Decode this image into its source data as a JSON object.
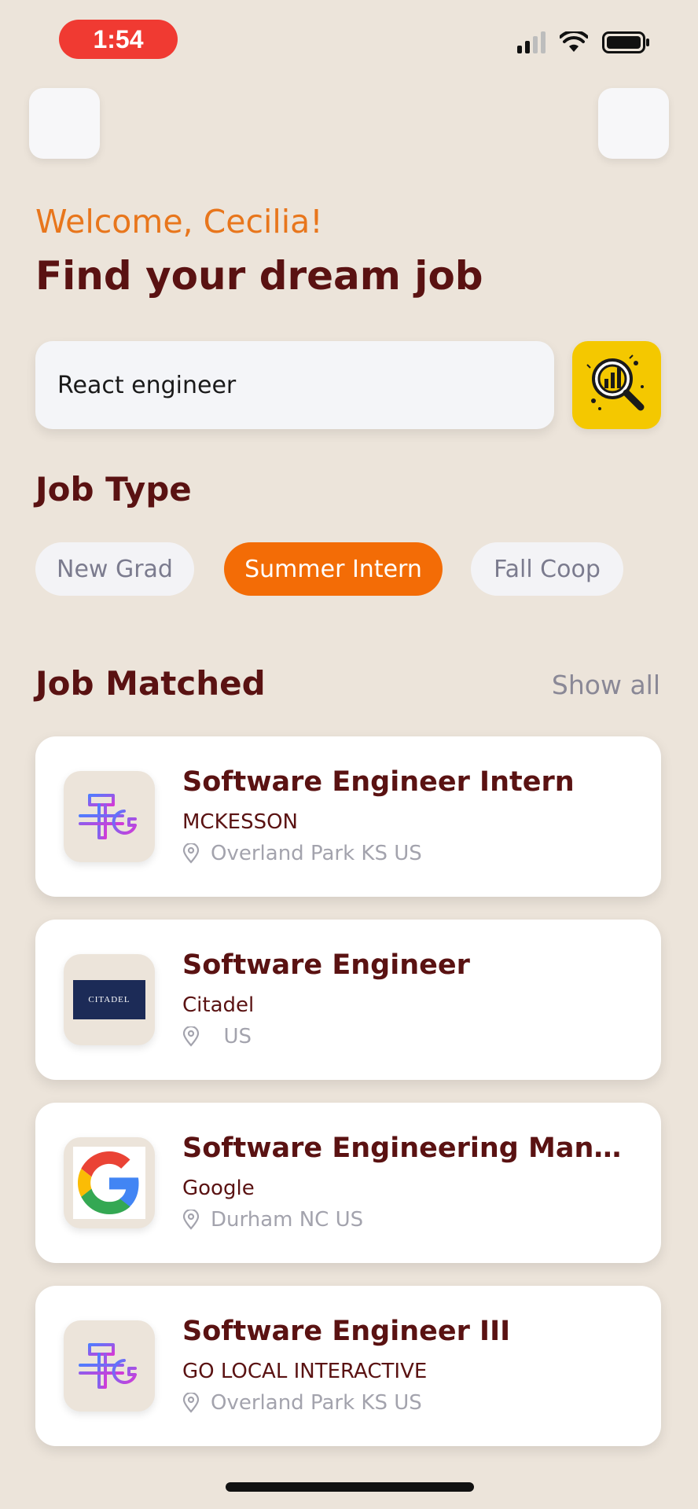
{
  "status_bar": {
    "time": "1:54",
    "icons": [
      "cellular-signal-icon",
      "wifi-icon",
      "battery-icon"
    ],
    "recording_color": "#f03a32"
  },
  "header": {
    "welcome": "Welcome, Cecilia!",
    "headline": "Find your dream job"
  },
  "search": {
    "value": "React engineer",
    "button_icon": "search-chart-icon",
    "button_color": "#f4c800"
  },
  "job_type": {
    "title": "Job Type",
    "chips": [
      {
        "label": "New Grad",
        "active": false
      },
      {
        "label": "Summer Intern",
        "active": true
      },
      {
        "label": "Fall Coop",
        "active": false
      }
    ]
  },
  "matched": {
    "title": "Job Matched",
    "show_all": "Show all",
    "jobs": [
      {
        "title": "Software Engineer Intern",
        "company": "MCKESSON",
        "location": "Overland Park KS US",
        "logo": "tools-icon"
      },
      {
        "title": "Software Engineer",
        "company": "Citadel",
        "location": "  US",
        "logo": "citadel-logo"
      },
      {
        "title": "Software Engineering Manag...",
        "company": "Google",
        "location": "Durham NC US",
        "logo": "google-logo"
      },
      {
        "title": "Software Engineer III",
        "company": "GO LOCAL INTERACTIVE",
        "location": "Overland Park KS US",
        "logo": "tools-icon"
      }
    ]
  },
  "logos": {
    "citadel_text": "CITADEL"
  },
  "colors": {
    "accent": "#f36c06",
    "title": "#5a1212",
    "welcome": "#e8761c",
    "background": "#ece4da"
  }
}
